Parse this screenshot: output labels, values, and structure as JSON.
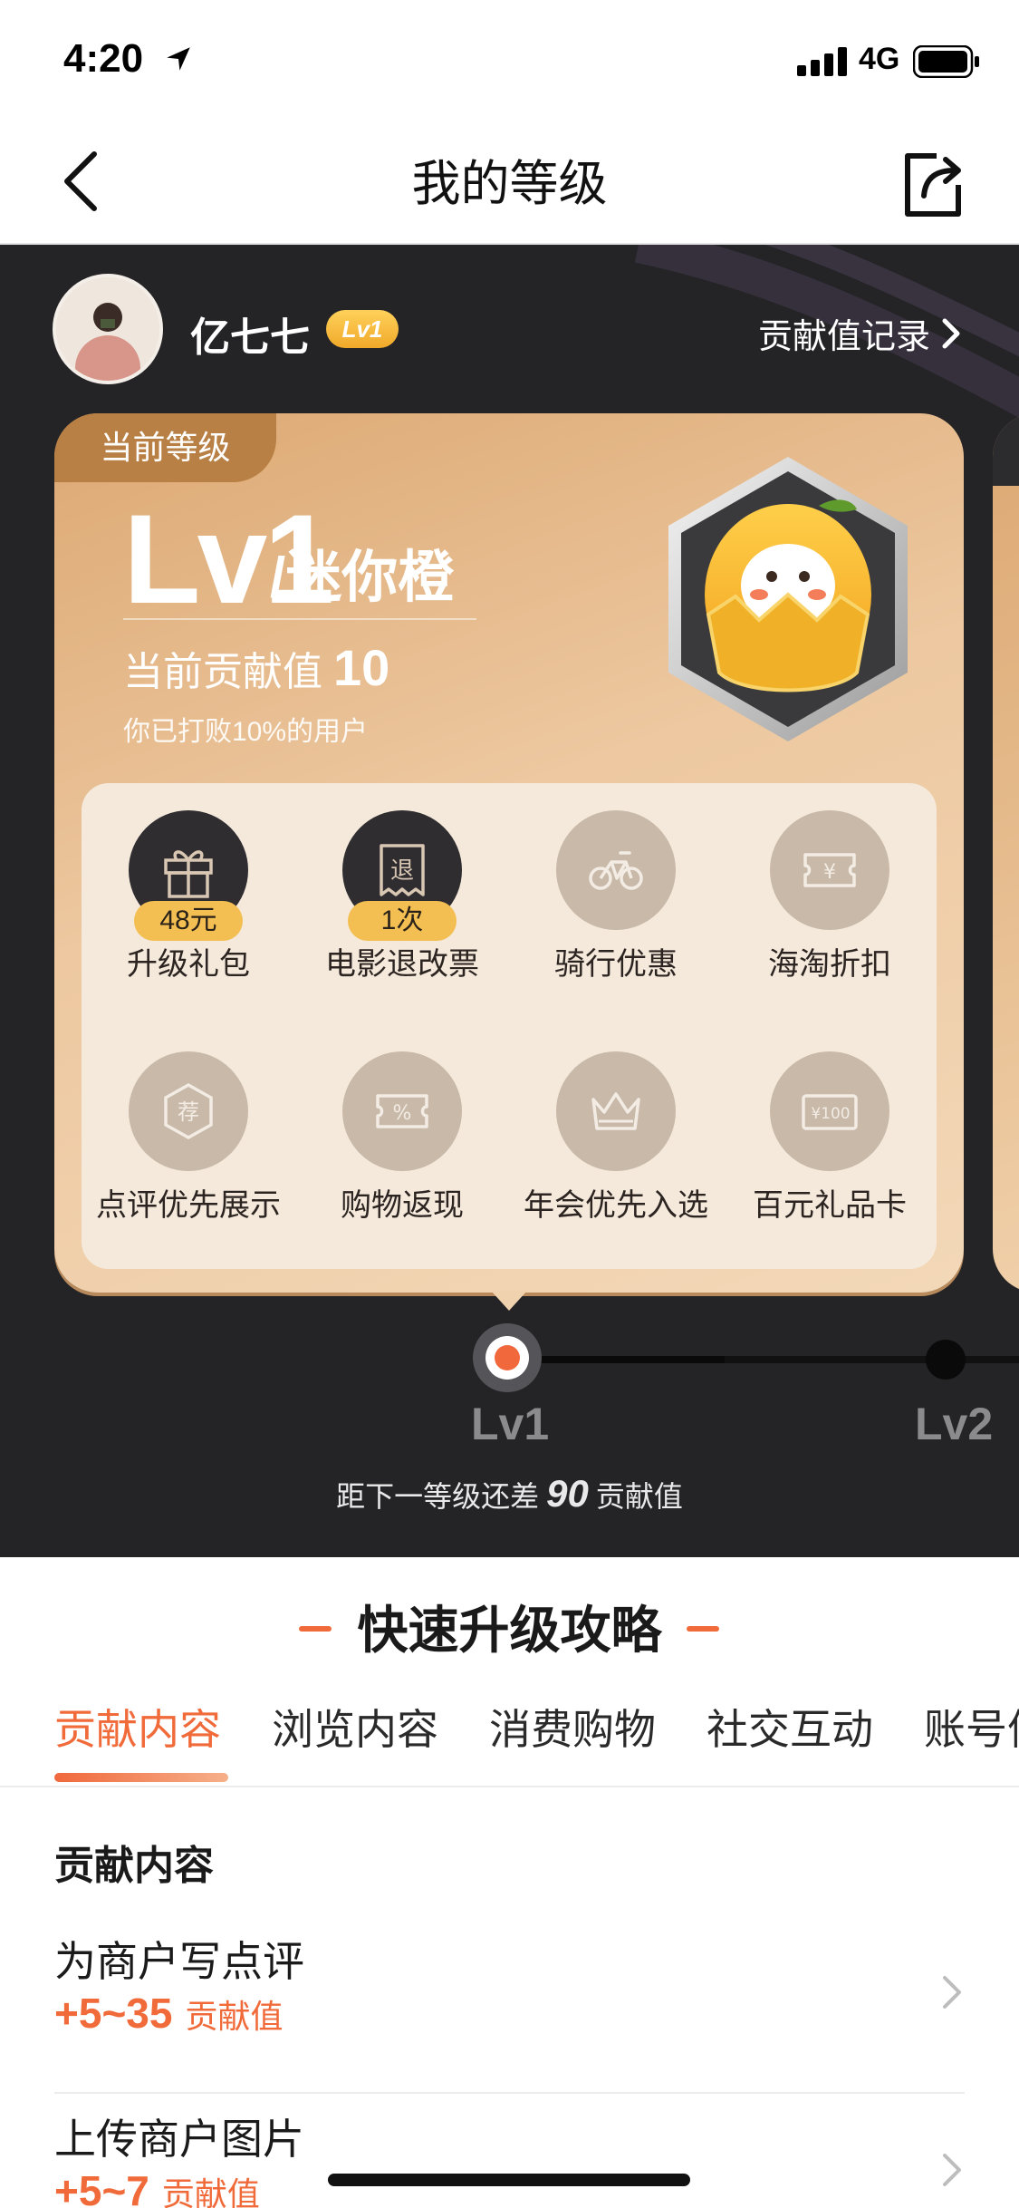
{
  "status": {
    "time": "4:20",
    "network": "4G"
  },
  "nav": {
    "title": "我的等级"
  },
  "user": {
    "name": "亿七七",
    "level_badge": "Lv1",
    "record_label": "贡献值记录"
  },
  "card": {
    "current_tag": "当前等级",
    "level": "Lv1",
    "level_name": "/迷你橙",
    "contribution_label": "当前贡献值",
    "contribution_value": "10",
    "beat_text": "你已打败10%的用户"
  },
  "benefits": [
    {
      "label": "升级礼包",
      "pill": "48元",
      "icon": "gift-icon",
      "unlocked": true
    },
    {
      "label": "电影退改票",
      "pill": "1次",
      "icon": "ticket-refund-icon",
      "unlocked": true
    },
    {
      "label": "骑行优惠",
      "pill": "",
      "icon": "bicycle-icon",
      "unlocked": false
    },
    {
      "label": "海淘折扣",
      "pill": "",
      "icon": "coupon-yen-icon",
      "unlocked": false
    },
    {
      "label": "点评优先展示",
      "pill": "",
      "icon": "recommend-badge-icon",
      "unlocked": false
    },
    {
      "label": "购物返现",
      "pill": "",
      "icon": "percent-coupon-icon",
      "unlocked": false
    },
    {
      "label": "年会优先入选",
      "pill": "",
      "icon": "crown-icon",
      "unlocked": false
    },
    {
      "label": "百元礼品卡",
      "pill": "",
      "icon": "gift-card-icon",
      "unlocked": false
    }
  ],
  "benefit_card_text": {
    "card100": "¥100",
    "recommend": "荐",
    "refund": "退"
  },
  "progress": {
    "current": "Lv1",
    "next": "Lv2",
    "to_next_prefix": "距下一等级还差",
    "to_next_value": "90",
    "to_next_suffix": "贡献值",
    "fraction": 0.1
  },
  "strategy": {
    "title": "快速升级攻略",
    "tabs": [
      "贡献内容",
      "浏览内容",
      "消费购物",
      "社交互动",
      "账号信息"
    ],
    "active_tab": 0,
    "section_title": "贡献内容",
    "items": [
      {
        "title": "为商户写点评",
        "value": "+5~35",
        "unit": "贡献值"
      },
      {
        "title": "上传商户图片",
        "value": "+5~7",
        "unit": "贡献值"
      }
    ]
  },
  "colors": {
    "accent": "#f06a3a",
    "dark_bg": "#242326",
    "gold": "#f3bf52"
  }
}
